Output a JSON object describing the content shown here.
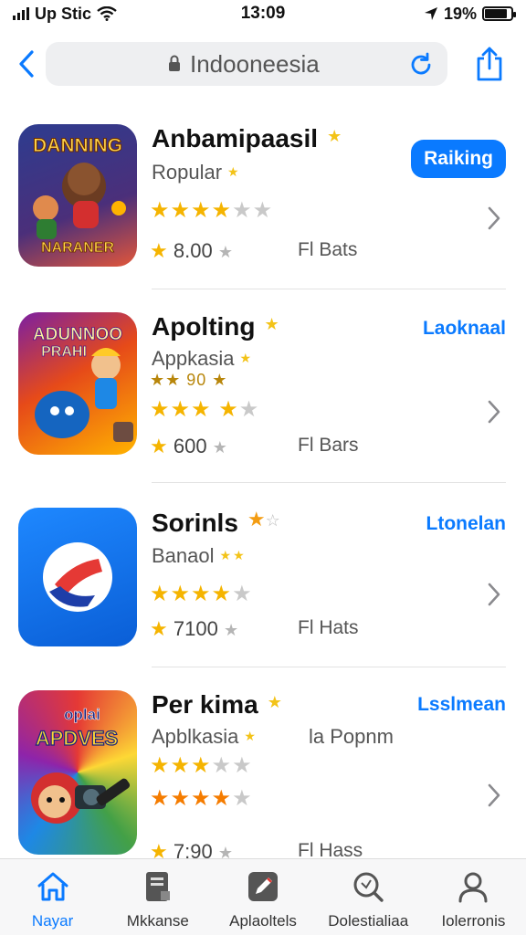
{
  "status_bar": {
    "carrier": "Up Stic",
    "time": "13:09",
    "battery": "19%",
    "battery_level": 0.85
  },
  "nav": {
    "search_text": "Indooneesia"
  },
  "apps": [
    {
      "title": "Anbamipaasil",
      "subtitle": "Ropular",
      "stars": "★★★★",
      "stars_off": "★★",
      "rating": "8.00",
      "meta": "Fl Bats",
      "action": "Raiking",
      "icon_text": [
        "DANNING",
        "NARANER"
      ]
    },
    {
      "title": "Apolting",
      "subtitle": "Appkasia",
      "sub_rating": "★★ 90 ★",
      "stars": "★★★ ★",
      "stars_off": "★",
      "rating": "600",
      "meta": "Fl Bars",
      "action": "Laoknaal",
      "icon_text": [
        "ADUNNOO",
        "PRAHI"
      ]
    },
    {
      "title": "Sorinls",
      "subtitle": "Banaol",
      "stars": "★★★★",
      "stars_off": "★",
      "rating": "7100",
      "meta": "Fl Hats",
      "action": "Ltonelan",
      "icon_text": []
    },
    {
      "title": "Per kima",
      "subtitle": "Apblkasia",
      "extra": "la Popnm",
      "sub_stars": "★★★",
      "sub_stars_off": "★★",
      "stars": "★★★★",
      "stars_off": "★",
      "rating": "7:90",
      "meta": "Fl Hass",
      "action": "Lsslmean",
      "icon_text": [
        "oplai",
        "APDVES"
      ]
    }
  ],
  "tabs": [
    {
      "label": "Nayar",
      "icon": "home-icon",
      "active": true
    },
    {
      "label": "Mkkanse",
      "icon": "document-icon",
      "active": false
    },
    {
      "label": "Aplaoltels",
      "icon": "edit-icon",
      "active": false
    },
    {
      "label": "Dolestialiaa",
      "icon": "search-icon",
      "active": false
    },
    {
      "label": "Iolerronis",
      "icon": "person-icon",
      "active": false
    }
  ],
  "colors": {
    "accent": "#0a7aff",
    "star": "#f5b400",
    "star_off": "#c9c9c9"
  }
}
